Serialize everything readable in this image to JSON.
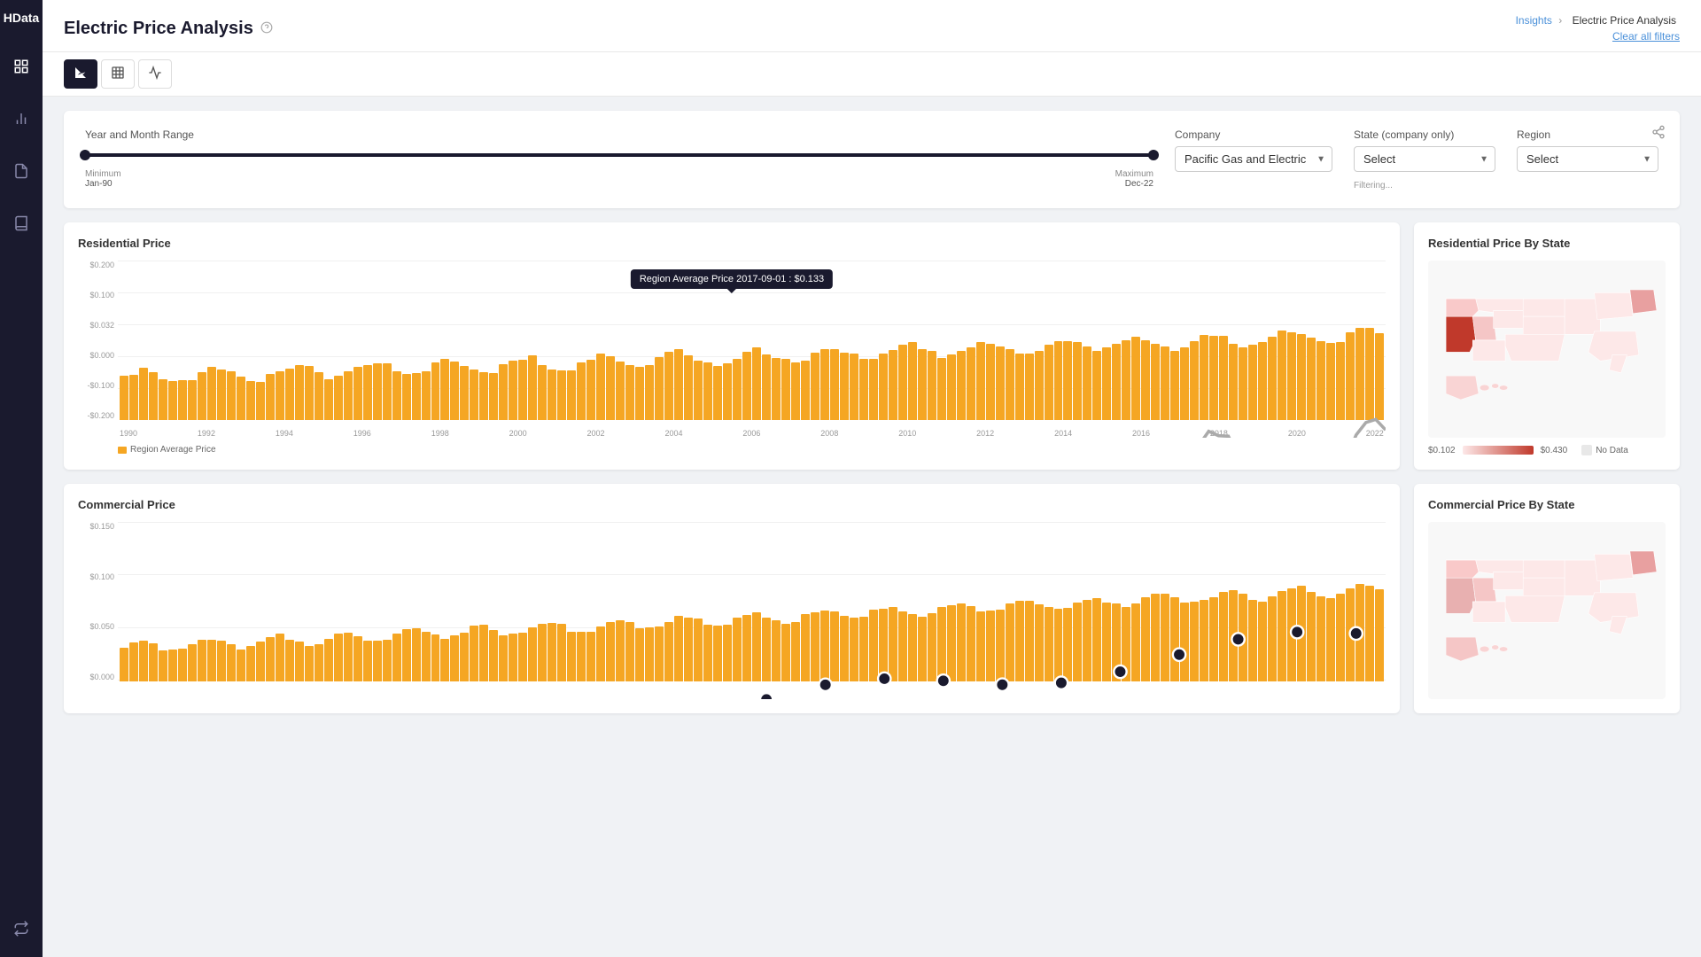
{
  "app": {
    "name": "HData",
    "logo": "HData"
  },
  "sidebar": {
    "items": [
      {
        "name": "dashboard-icon",
        "icon": "⊞",
        "active": false
      },
      {
        "name": "chart-icon",
        "icon": "📊",
        "active": true
      },
      {
        "name": "document-icon",
        "icon": "📄",
        "active": false
      },
      {
        "name": "library-icon",
        "icon": "📚",
        "active": false
      }
    ]
  },
  "header": {
    "title": "Electric Price Analysis",
    "breadcrumb": {
      "parent": "Insights",
      "current": "Electric Price Analysis"
    },
    "clear_filters": "Clear all filters"
  },
  "toolbar": {
    "buttons": [
      {
        "name": "bar-chart-btn",
        "icon": "📈",
        "active": true
      },
      {
        "name": "table-btn",
        "icon": "⊞",
        "active": false
      },
      {
        "name": "trend-btn",
        "icon": "〰",
        "active": false
      }
    ]
  },
  "filters": {
    "date_range_label": "Year and Month Range",
    "date_min_label": "Minimum",
    "date_min_value": "Jan-90",
    "date_max_label": "Maximum",
    "date_max_value": "Dec-22",
    "company_label": "Company",
    "company_value": "Pacific Gas and Electric",
    "company_placeholder": "Pacific Gas and Electric",
    "state_label": "State (company only)",
    "state_placeholder": "Select",
    "region_label": "Region",
    "region_placeholder": "Select",
    "filtering_text": "Filtering..."
  },
  "residential_chart": {
    "title": "Residential Price",
    "tooltip": "Region Average Price 2017-09-01 : $0.133",
    "y_labels": [
      "$0.200",
      "$0.100",
      "$0.032",
      "$0.000",
      "-$0.100",
      "-$0.200"
    ],
    "x_labels": [
      "1990",
      "1992",
      "1994",
      "1996",
      "1998",
      "2000",
      "2002",
      "2004",
      "2006",
      "2008",
      "2010",
      "2012",
      "2014",
      "2016",
      "2018",
      "2020",
      "2022"
    ],
    "legend_items": [
      {
        "label": "Region Average Price",
        "type": "rect",
        "color": "#f5a623"
      }
    ]
  },
  "residential_map": {
    "title": "Residential Price By State",
    "legend_min": "$0.102",
    "legend_max": "$0.430",
    "no_data": "No Data"
  },
  "commercial_chart": {
    "title": "Commercial Price"
  },
  "commercial_map": {
    "title": "Commercial Price By State"
  },
  "colors": {
    "brand": "#1a1a2e",
    "orange": "#f5a623",
    "light_red": "#f9d4d4",
    "dark_red": "#c0392b",
    "link": "#4a90d9"
  }
}
